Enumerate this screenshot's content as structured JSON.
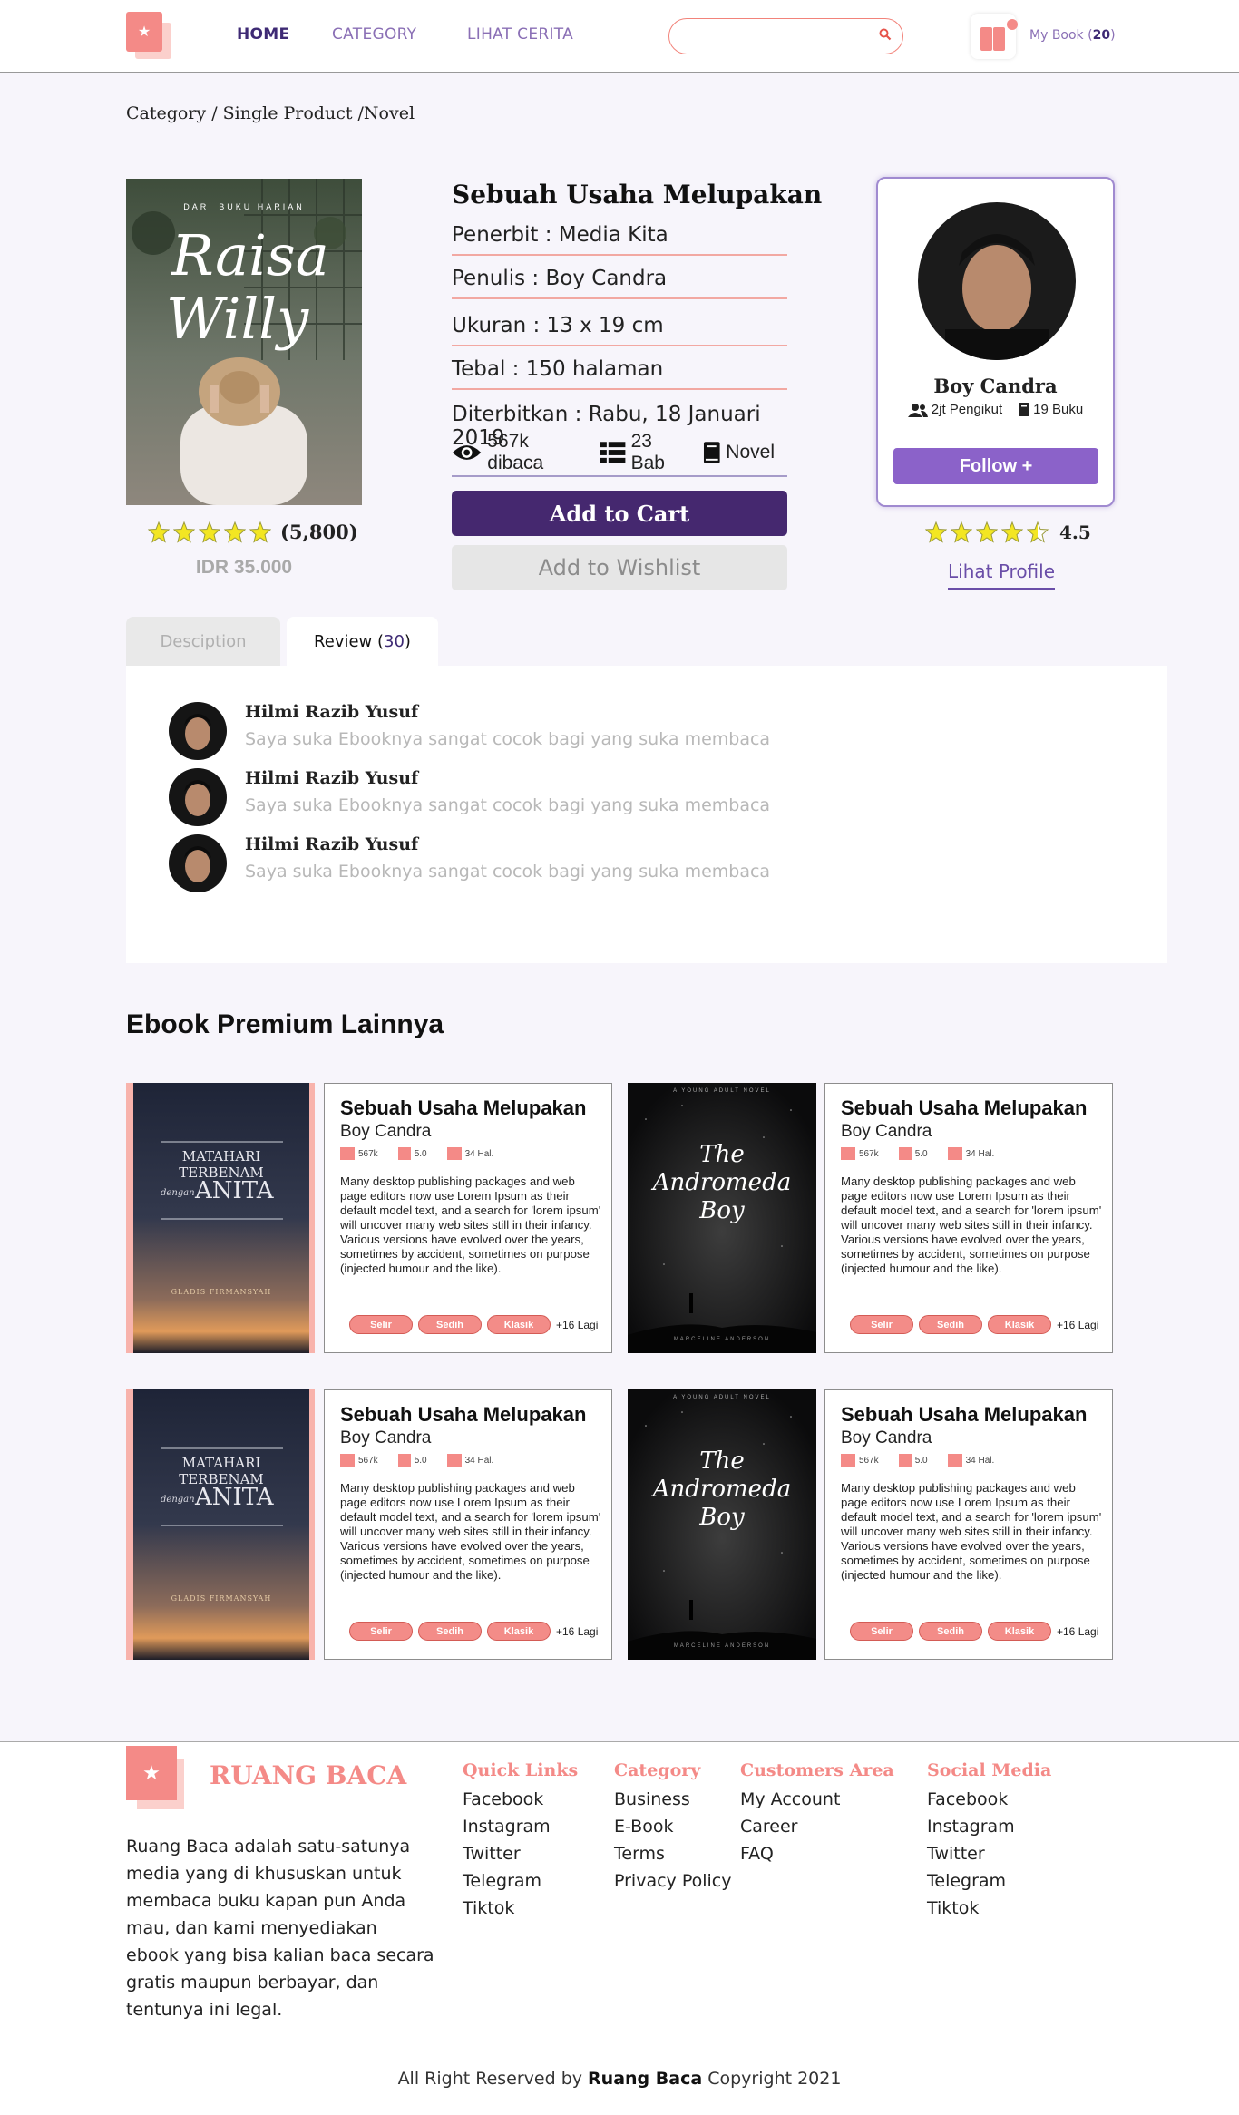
{
  "header": {
    "nav": [
      "HOME",
      "CATEGORY",
      "LIHAT CERITA"
    ],
    "search_placeholder": "",
    "mybook_label": "My Book (",
    "mybook_count": "20",
    "mybook_close": ")"
  },
  "breadcrumb": "Category / Single Product /Novel",
  "product": {
    "cover_title_top": "DARI BUKU HARIAN",
    "cover_title_1": "Raisa",
    "cover_title_2": "Willy",
    "rating_count": "(5,800)",
    "price": "IDR 35.000",
    "title": "Sebuah Usaha Melupakan",
    "penerbit": "Penerbit : Media Kita",
    "penulis": "Penulis : Boy Candra",
    "ukuran": "Ukuran : 13 x 19 cm",
    "tebal": "Tebal : 150 halaman",
    "diterbitkan": "Diterbitkan : Rabu, 18 Januari 2019",
    "views": "567k dibaca",
    "chapters": "23 Bab",
    "genre": "Novel",
    "add_to_cart": "Add to Cart",
    "add_to_wishlist": "Add to Wishlist",
    "star_rating": 5
  },
  "author": {
    "name": "Boy Candra",
    "followers": "2jt Pengikut",
    "books": "19 Buku",
    "follow_label": "Follow +",
    "rating": "4.5",
    "profile_link": "Lihat Profile"
  },
  "tabs": {
    "description": "Desciption",
    "review_label": "Review (",
    "review_count": "30",
    "review_close": ")"
  },
  "reviews": [
    {
      "name": "Hilmi Razib Yusuf",
      "text": "Saya suka Ebooknya sangat cocok bagi yang suka membaca"
    },
    {
      "name": "Hilmi Razib Yusuf",
      "text": "Saya suka Ebooknya sangat cocok bagi yang suka membaca"
    },
    {
      "name": "Hilmi Razib Yusuf",
      "text": "Saya suka Ebooknya sangat cocok bagi yang suka membaca"
    }
  ],
  "premium": {
    "section_title": "Ebook Premium Lainnya",
    "books": [
      {
        "cover": "matahari",
        "cover_lines": [
          "MATAHARI",
          "TERBENAM",
          "dengan",
          "ANITA",
          "GLADIS FIRMANSYAH"
        ],
        "title": "Sebuah Usaha Melupakan",
        "author": "Boy Candra",
        "stats": [
          "567k",
          "5.0",
          "34 Hal."
        ],
        "desc": "Many desktop publishing packages and web page editors now use Lorem Ipsum as their default model text, and a search for 'lorem ipsum' will uncover many web sites still in their infancy. Various versions have evolved over the years, sometimes by accident, sometimes on purpose (injected humour and the like).",
        "tags": [
          "Selir",
          "Sedih",
          "Klasik"
        ],
        "more": "+16 Lagi"
      },
      {
        "cover": "andromeda",
        "cover_lines": [
          "A YOUNG ADULT NOVEL",
          "The",
          "Andromeda",
          "Boy",
          "MARCELINE ANDERSON"
        ],
        "title": "Sebuah Usaha Melupakan",
        "author": "Boy Candra",
        "stats": [
          "567k",
          "5.0",
          "34 Hal."
        ],
        "desc": "Many desktop publishing packages and web page editors now use Lorem Ipsum as their default model text, and a search for 'lorem ipsum' will uncover many web sites still in their infancy. Various versions have evolved over the years, sometimes by accident, sometimes on purpose (injected humour and the like).",
        "tags": [
          "Selir",
          "Sedih",
          "Klasik"
        ],
        "more": "+16 Lagi"
      },
      {
        "cover": "matahari",
        "cover_lines": [
          "MATAHARI",
          "TERBENAM",
          "dengan",
          "ANITA",
          "GLADIS FIRMANSYAH"
        ],
        "title": "Sebuah Usaha Melupakan",
        "author": "Boy Candra",
        "stats": [
          "567k",
          "5.0",
          "34 Hal."
        ],
        "desc": "Many desktop publishing packages and web page editors now use Lorem Ipsum as their default model text, and a search for 'lorem ipsum' will uncover many web sites still in their infancy. Various versions have evolved over the years, sometimes by accident, sometimes on purpose (injected humour and the like).",
        "tags": [
          "Selir",
          "Sedih",
          "Klasik"
        ],
        "more": "+16 Lagi"
      },
      {
        "cover": "andromeda",
        "cover_lines": [
          "A YOUNG ADULT NOVEL",
          "The",
          "Andromeda",
          "Boy",
          "MARCELINE ANDERSON"
        ],
        "title": "Sebuah Usaha Melupakan",
        "author": "Boy Candra",
        "stats": [
          "567k",
          "5.0",
          "34 Hal."
        ],
        "desc": "Many desktop publishing packages and web page editors now use Lorem Ipsum as their default model text, and a search for 'lorem ipsum' will uncover many web sites still in their infancy. Various versions have evolved over the years, sometimes by accident, sometimes on purpose (injected humour and the like).",
        "tags": [
          "Selir",
          "Sedih",
          "Klasik"
        ],
        "more": "+16 Lagi"
      }
    ]
  },
  "footer": {
    "brand": "RUANG BACA",
    "about": "Ruang Baca adalah satu-satunya media yang di khususkan untuk membaca buku kapan pun Anda mau, dan kami menyediakan ebook yang bisa kalian baca secara gratis maupun berbayar, dan tentunya ini legal.",
    "columns": [
      {
        "title": "Quick Links",
        "links": [
          "Facebook",
          "Instagram",
          "Twitter",
          "Telegram",
          "Tiktok"
        ]
      },
      {
        "title": "Category",
        "links": [
          "Business",
          "E-Book",
          "Terms",
          "Privacy Policy"
        ]
      },
      {
        "title": "Customers Area",
        "links": [
          "My Account",
          "Career",
          "FAQ"
        ]
      },
      {
        "title": "Social Media",
        "links": [
          "Facebook",
          "Instagram",
          "Twitter",
          "Telegram",
          "Tiktok"
        ]
      }
    ],
    "copyright_pre": "All Right Reserved by ",
    "copyright_brand": "Ruang Baca",
    "copyright_post": " Copyright 2021"
  },
  "colors": {
    "accent_pink": "#f48a87",
    "primary_purple": "#45286f",
    "follow_purple": "#8b62c9",
    "star_yellow": "#f3e622"
  }
}
